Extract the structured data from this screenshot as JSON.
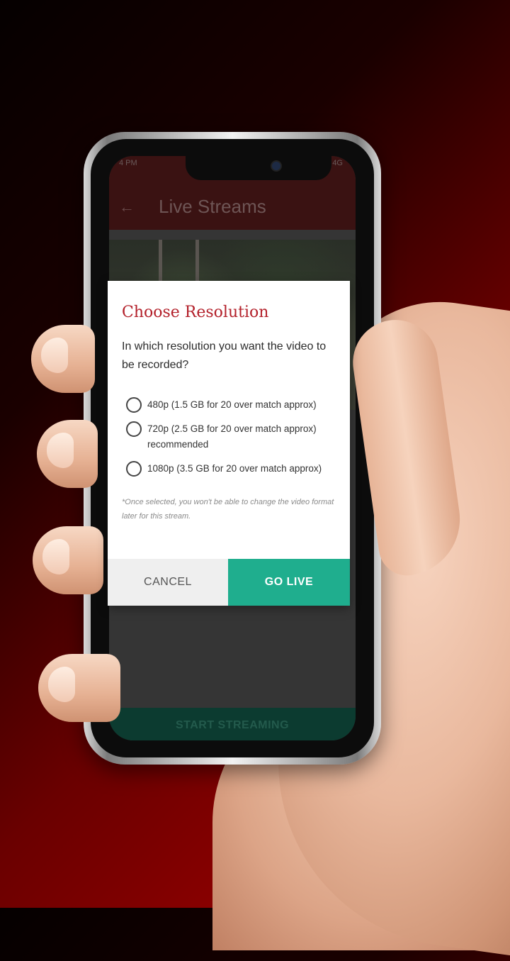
{
  "status_bar": {
    "left": "4 PM",
    "right": "4G"
  },
  "app_bar": {
    "back_icon": "arrow-left-icon",
    "title": "Live Streams"
  },
  "dialog": {
    "title": "Choose Resolution",
    "question": "In which resolution you want the video to be recorded?",
    "options": [
      {
        "label": "480p (1.5 GB for 20 over match approx)",
        "selected": false
      },
      {
        "label": "720p (2.5 GB for 20 over match approx) recommended",
        "selected": false
      },
      {
        "label": "1080p (3.5 GB for 20 over match approx)",
        "selected": false
      }
    ],
    "note": "*Once selected, you won't be able to change the video format later for this stream.",
    "cancel_label": "CANCEL",
    "go_live_label": "GO LIVE"
  },
  "bottom_button": {
    "label": "START STREAMING"
  },
  "colors": {
    "accent": "#1fae8e",
    "title_red": "#b3202a",
    "app_bar": "#3a1212"
  }
}
